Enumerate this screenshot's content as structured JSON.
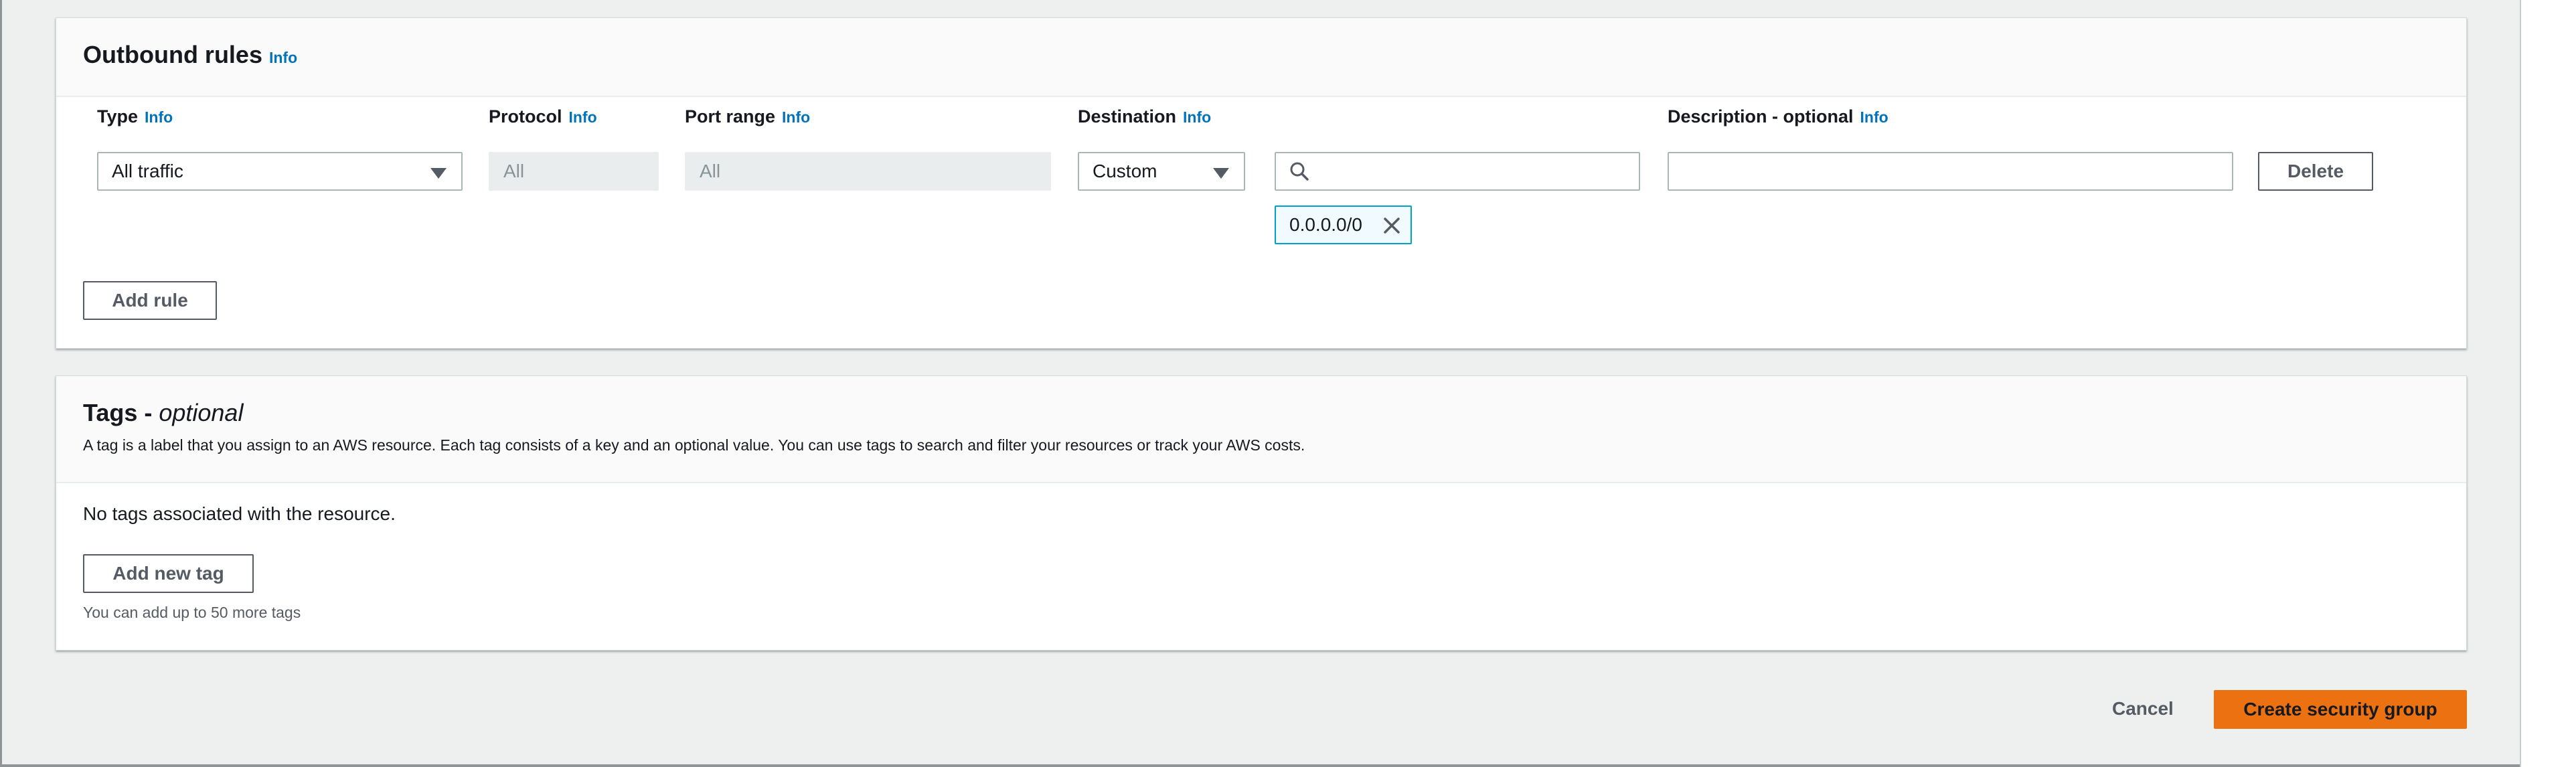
{
  "outbound": {
    "title": "Outbound rules",
    "info": "Info",
    "columns": {
      "type": "Type",
      "protocol": "Protocol",
      "port_range": "Port range",
      "destination": "Destination",
      "description": "Description - optional"
    },
    "rule": {
      "type_value": "All traffic",
      "protocol_value": "All",
      "port_range_value": "All",
      "destination_value": "Custom",
      "destination_token": "0.0.0.0/0",
      "search_placeholder": "",
      "description_value": ""
    },
    "delete_label": "Delete",
    "add_rule_label": "Add rule"
  },
  "tags": {
    "title_main": "Tags - ",
    "title_optional": "optional",
    "description": "A tag is a label that you assign to an AWS resource. Each tag consists of a key and an optional value. You can use tags to search and filter your resources or track your AWS costs.",
    "empty_text": "No tags associated with the resource.",
    "add_label": "Add new tag",
    "limit_text": "You can add up to 50 more tags"
  },
  "footer": {
    "cancel_label": "Cancel",
    "create_label": "Create security group"
  },
  "colors": {
    "link": "#0073bb",
    "primary": "#ec7211",
    "token_border": "#00a1c9"
  },
  "icons": [
    "chevron-down-icon",
    "search-icon",
    "close-icon"
  ]
}
